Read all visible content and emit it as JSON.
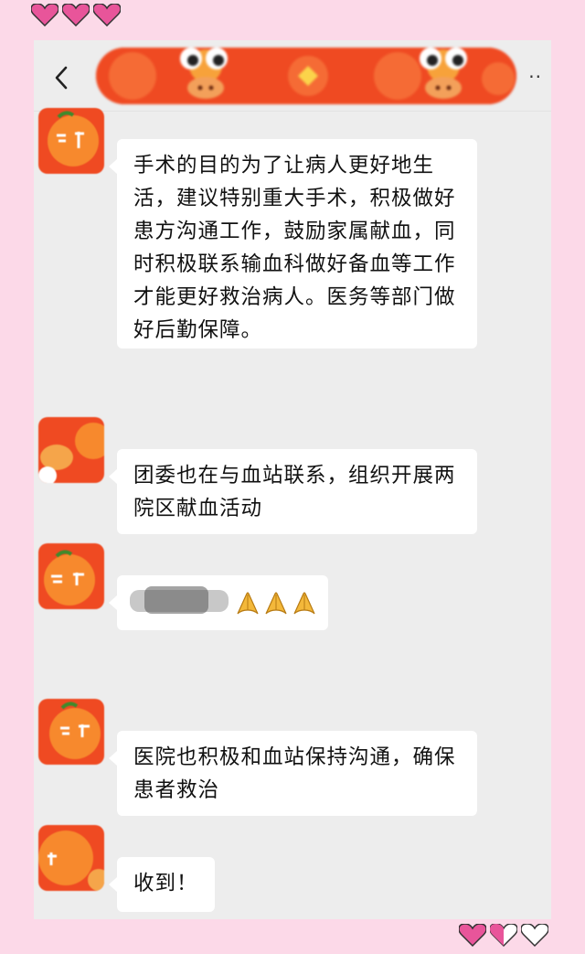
{
  "decorations": {
    "top_hearts": [
      "pink-heart-icon",
      "pink-heart-icon",
      "pink-heart-icon"
    ],
    "bottom_hearts": [
      "pink-heart-icon",
      "half-pink-heart-icon",
      "white-heart-icon"
    ],
    "accent_pink": "#e8559a"
  },
  "header": {
    "back_icon": "chevron-left-icon",
    "banner": "blurred-chat-title-banner",
    "more_icon": "more-dots-icon",
    "more_label": "··"
  },
  "messages": [
    {
      "avatar": "blurred-orange-new-year-avatar",
      "text": "手术的目的为了让病人更好地生活，建议特别重大手术，积极做好患方沟通工作，鼓励家属献血，同时积极联系输血科做好备血等工作才能更好救治病人。医务等部门做好后勤保障。"
    },
    {
      "avatar": "blurred-orange-new-year-avatar",
      "text": "团委也在与血站联系，组织开展两院区献血活动"
    },
    {
      "avatar": "blurred-orange-new-year-avatar",
      "text": "",
      "emoji": [
        "folded-hands-icon",
        "folded-hands-icon",
        "folded-hands-icon"
      ]
    },
    {
      "avatar": "blurred-orange-new-year-avatar",
      "text": "医院也积极和血站保持沟通，确保患者救治"
    },
    {
      "avatar": "blurred-orange-new-year-avatar",
      "text": "收到！"
    }
  ],
  "colors": {
    "page_background": "#fcd9e8",
    "chat_background": "#ededed",
    "bubble": "#ffffff",
    "avatar_orange": "#ef4a22"
  }
}
